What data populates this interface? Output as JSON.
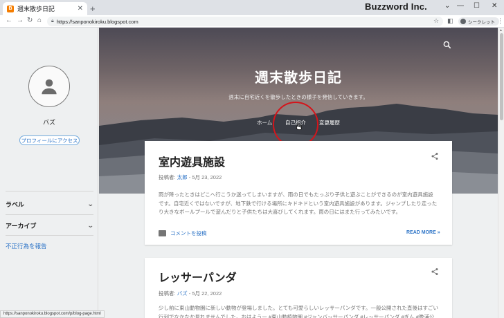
{
  "browser": {
    "tab_title": "週末散歩日記",
    "tab_close": "✕",
    "new_tab": "+",
    "brand_overlay": "Buzzword Inc.",
    "url": "https://sanponokiroku.blogspot.com",
    "profile_label": "シークレット",
    "status_url": "https://sanponokiroku.blogspot.com/p/blog-page.html",
    "window_controls": [
      "⌄",
      "—",
      "☐",
      "✕"
    ]
  },
  "sidebar": {
    "author_name": "バズ",
    "profile_button": "プロフィールにアクセス",
    "sections": [
      {
        "label": "ラベル"
      },
      {
        "label": "アーカイブ"
      }
    ],
    "report_link": "不正行為を報告"
  },
  "header": {
    "title": "週末散歩日記",
    "description": "週末に自宅近くを散歩したときの様子を発信していきます。",
    "nav": [
      {
        "label": "ホーム"
      },
      {
        "label": "自己紹介"
      },
      {
        "label": "変更履歴"
      }
    ]
  },
  "posts": [
    {
      "title": "室内遊具施設",
      "byline_prefix": "投稿者:",
      "author": "太郎",
      "date": "- 5月 23, 2022",
      "snippet": "雨が降ったときはどこへ行こうか迷ってしまいますが、雨の日でもたっぷり子供と遊ぶことができるのが室内遊具施設です。自宅近くではないですが、地下鉄で行ける場所にキドキドという室内遊具施設があります。ジャンプしたり走ったり大きなボールプールで遊んだりと子供たちは大喜びしてくれます。雨の日にはまた行ってみたいです。",
      "comment_label": "コメントを投稿",
      "read_more": "READ MORE »"
    },
    {
      "title": "レッサーパンダ",
      "byline_prefix": "投稿者:",
      "author": "バズ",
      "date": "- 5月 22, 2022",
      "snippet": "少し前に東山動物園に新しい動物が登場しました。とても可愛らしいレッサーパンダです。一般公開された直後はすごい行列でなかなか見れませんでした。おはようー #東山動植物園 #ジャンバッサーパンダ #レッサーパンダ #ぎん #晩浦公"
    }
  ]
}
